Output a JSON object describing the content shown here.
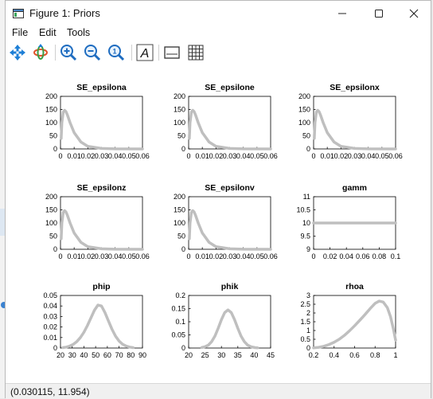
{
  "window": {
    "title": "Figure 1: Priors"
  },
  "menu": {
    "file": "File",
    "edit": "Edit",
    "tools": "Tools"
  },
  "toolbar": [
    {
      "name": "pan-button",
      "icon": "move-arrows-icon"
    },
    {
      "name": "rotate-button",
      "icon": "rotate-icon"
    },
    {
      "name": "zoom-in-button",
      "icon": "zoom-in-icon"
    },
    {
      "name": "zoom-out-button",
      "icon": "zoom-out-icon"
    },
    {
      "name": "reset-zoom-button",
      "icon": "zoom-reset-icon"
    },
    {
      "name": "text-button",
      "icon": "text-icon",
      "label": "A"
    },
    {
      "name": "axes-button",
      "icon": "axes-icon"
    },
    {
      "name": "grid-button",
      "icon": "grid-icon"
    }
  ],
  "status": {
    "coords": "(0.030115, 11.954)"
  },
  "colors": {
    "line": "#bfbfbf",
    "axis": "#000000",
    "background": "#ffffff"
  },
  "chart_data": [
    {
      "type": "line",
      "title": "SE_epsilona",
      "xlim": [
        0,
        0.06
      ],
      "ylim": [
        0,
        200
      ],
      "xticks": [
        "0",
        "0.01",
        "0.02",
        "0.03",
        "0.04",
        "0.05",
        "0.06"
      ],
      "yticks": [
        "0",
        "50",
        "100",
        "150",
        "200"
      ],
      "x": [
        0.0005,
        0.001,
        0.002,
        0.003,
        0.004,
        0.005,
        0.007,
        0.01,
        0.015,
        0.02,
        0.03,
        0.04,
        0.06
      ],
      "y": [
        40,
        100,
        140,
        147,
        142,
        130,
        100,
        62,
        26,
        10,
        2,
        0.4,
        0
      ]
    },
    {
      "type": "line",
      "title": "SE_epsilone",
      "xlim": [
        0,
        0.06
      ],
      "ylim": [
        0,
        200
      ],
      "xticks": [
        "0",
        "0.01",
        "0.02",
        "0.03",
        "0.04",
        "0.05",
        "0.06"
      ],
      "yticks": [
        "0",
        "50",
        "100",
        "150",
        "200"
      ],
      "x": [
        0.0005,
        0.001,
        0.002,
        0.003,
        0.004,
        0.005,
        0.007,
        0.01,
        0.015,
        0.02,
        0.03,
        0.04,
        0.06
      ],
      "y": [
        40,
        100,
        140,
        147,
        142,
        130,
        100,
        62,
        26,
        10,
        2,
        0.4,
        0
      ]
    },
    {
      "type": "line",
      "title": "SE_epsilonx",
      "xlim": [
        0,
        0.06
      ],
      "ylim": [
        0,
        200
      ],
      "xticks": [
        "0",
        "0.01",
        "0.02",
        "0.03",
        "0.04",
        "0.05",
        "0.06"
      ],
      "yticks": [
        "0",
        "50",
        "100",
        "150",
        "200"
      ],
      "x": [
        0.0005,
        0.001,
        0.002,
        0.003,
        0.004,
        0.005,
        0.007,
        0.01,
        0.015,
        0.02,
        0.03,
        0.04,
        0.06
      ],
      "y": [
        40,
        100,
        140,
        147,
        142,
        130,
        100,
        62,
        26,
        10,
        2,
        0.4,
        0
      ]
    },
    {
      "type": "line",
      "title": "SE_epsilonz",
      "xlim": [
        0,
        0.06
      ],
      "ylim": [
        0,
        200
      ],
      "xticks": [
        "0",
        "0.01",
        "0.02",
        "0.03",
        "0.04",
        "0.05",
        "0.06"
      ],
      "yticks": [
        "0",
        "50",
        "100",
        "150",
        "200"
      ],
      "x": [
        0.0005,
        0.001,
        0.002,
        0.003,
        0.004,
        0.005,
        0.007,
        0.01,
        0.015,
        0.02,
        0.03,
        0.04,
        0.06
      ],
      "y": [
        40,
        100,
        140,
        147,
        142,
        130,
        100,
        62,
        26,
        10,
        2,
        0.4,
        0
      ]
    },
    {
      "type": "line",
      "title": "SE_epsilonv",
      "xlim": [
        0,
        0.06
      ],
      "ylim": [
        0,
        200
      ],
      "xticks": [
        "0",
        "0.01",
        "0.02",
        "0.03",
        "0.04",
        "0.05",
        "0.06"
      ],
      "yticks": [
        "0",
        "50",
        "100",
        "150",
        "200"
      ],
      "x": [
        0.0005,
        0.001,
        0.002,
        0.003,
        0.004,
        0.005,
        0.007,
        0.01,
        0.015,
        0.02,
        0.03,
        0.04,
        0.06
      ],
      "y": [
        40,
        100,
        140,
        147,
        142,
        130,
        100,
        62,
        26,
        10,
        2,
        0.4,
        0
      ]
    },
    {
      "type": "line",
      "title": "gamm",
      "xlim": [
        0,
        0.1
      ],
      "ylim": [
        9,
        11
      ],
      "xticks": [
        "0",
        "0.02",
        "0.04",
        "0.06",
        "0.08",
        "0.1"
      ],
      "yticks": [
        "9",
        "9.5",
        "10",
        "10.5",
        "11"
      ],
      "x": [
        0,
        0.1
      ],
      "y": [
        10,
        10
      ]
    },
    {
      "type": "line",
      "title": "phip",
      "xlim": [
        20,
        90
      ],
      "ylim": [
        0,
        0.05
      ],
      "xticks": [
        "20",
        "30",
        "40",
        "50",
        "60",
        "70",
        "80",
        "90"
      ],
      "yticks": [
        "0",
        "0.01",
        "0.02",
        "0.03",
        "0.04",
        "0.05"
      ],
      "x": [
        22,
        25,
        28,
        31,
        34,
        37,
        40,
        43,
        46,
        49,
        52,
        55,
        58,
        61,
        64,
        67,
        70,
        73,
        76,
        79,
        82
      ],
      "y": [
        0.0004,
        0.0009,
        0.0019,
        0.0036,
        0.0062,
        0.01,
        0.015,
        0.0214,
        0.0287,
        0.036,
        0.0409,
        0.04,
        0.0337,
        0.0256,
        0.0178,
        0.0113,
        0.0067,
        0.0036,
        0.0019,
        0.0009,
        0.0004
      ]
    },
    {
      "type": "line",
      "title": "phik",
      "xlim": [
        20,
        45
      ],
      "ylim": [
        0,
        0.2
      ],
      "xticks": [
        "20",
        "25",
        "30",
        "35",
        "40",
        "45"
      ],
      "yticks": [
        "0",
        "0.05",
        "0.1",
        "0.15",
        "0.2"
      ],
      "x": [
        24,
        25,
        26,
        27,
        28,
        29,
        30,
        31,
        32,
        33,
        34,
        35,
        36,
        37,
        38,
        39,
        40,
        41
      ],
      "y": [
        0.002,
        0.005,
        0.011,
        0.024,
        0.045,
        0.075,
        0.108,
        0.135,
        0.145,
        0.135,
        0.108,
        0.075,
        0.045,
        0.024,
        0.011,
        0.005,
        0.002,
        0.0008
      ]
    },
    {
      "type": "line",
      "title": "rhoa",
      "xlim": [
        0.2,
        1
      ],
      "ylim": [
        0,
        3
      ],
      "xticks": [
        "0.2",
        "0.4",
        "0.6",
        "0.8",
        "1"
      ],
      "yticks": [
        "0",
        "0.5",
        "1",
        "1.5",
        "2",
        "2.5",
        "3"
      ],
      "x": [
        0.2,
        0.25,
        0.3,
        0.35,
        0.4,
        0.45,
        0.5,
        0.55,
        0.6,
        0.65,
        0.7,
        0.75,
        0.8,
        0.84,
        0.88,
        0.92,
        0.95,
        0.98,
        1.0
      ],
      "y": [
        0.01,
        0.04,
        0.1,
        0.2,
        0.33,
        0.5,
        0.72,
        0.98,
        1.27,
        1.58,
        1.9,
        2.24,
        2.55,
        2.68,
        2.62,
        2.3,
        1.8,
        1.05,
        0.45
      ]
    }
  ]
}
